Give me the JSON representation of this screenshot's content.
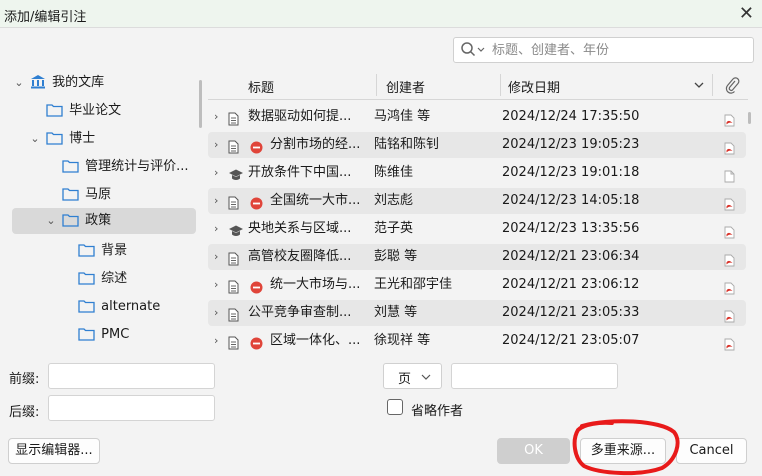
{
  "window": {
    "title": "添加/编辑引注",
    "close_glyph": "✕"
  },
  "search": {
    "placeholder": "标题、创建者、年份",
    "value": ""
  },
  "tree": {
    "items": [
      {
        "label": "我的文库",
        "icon": "library-icon",
        "twisty": "⌄"
      },
      {
        "label": "毕业论文",
        "icon": "folder-icon",
        "twisty": ""
      },
      {
        "label": "博士",
        "icon": "folder-icon",
        "twisty": "⌄"
      },
      {
        "label": "管理统计与评价...",
        "icon": "folder-icon",
        "twisty": ""
      },
      {
        "label": "马原",
        "icon": "folder-icon",
        "twisty": ""
      },
      {
        "label": "政策",
        "icon": "folder-icon",
        "twisty": "⌄"
      },
      {
        "label": "背景",
        "icon": "folder-icon",
        "twisty": ""
      },
      {
        "label": "综述",
        "icon": "folder-icon",
        "twisty": ""
      },
      {
        "label": "alternate",
        "icon": "folder-icon",
        "twisty": ""
      },
      {
        "label": "PMC",
        "icon": "folder-icon",
        "twisty": ""
      }
    ]
  },
  "table": {
    "headers": {
      "title": "标题",
      "creator": "创建者",
      "date": "修改日期",
      "attachment_icon": "paperclip-icon"
    },
    "rows": [
      {
        "type": "document",
        "retracted": false,
        "title": "数据驱动如何提...",
        "creator": "马鸿佳 等",
        "date": "2024/12/24 17:35:50",
        "attachment": "pdf"
      },
      {
        "type": "document",
        "retracted": true,
        "title": "分割市场的经...",
        "creator": "陆铭和陈钊",
        "date": "2024/12/23 19:05:23",
        "attachment": "pdf"
      },
      {
        "type": "thesis",
        "retracted": false,
        "title": "开放条件下中国...",
        "creator": "陈维佳",
        "date": "2024/12/23 19:01:18",
        "attachment": "file"
      },
      {
        "type": "document",
        "retracted": true,
        "title": "全国统一大市...",
        "creator": "刘志彪",
        "date": "2024/12/23 14:05:18",
        "attachment": "pdf"
      },
      {
        "type": "thesis",
        "retracted": false,
        "title": "央地关系与区域...",
        "creator": "范子英",
        "date": "2024/12/23 13:35:56",
        "attachment": "pdf"
      },
      {
        "type": "document",
        "retracted": false,
        "title": "高管校友圈降低...",
        "creator": "彭聪 等",
        "date": "2024/12/21 23:06:34",
        "attachment": "pdf"
      },
      {
        "type": "document",
        "retracted": true,
        "title": "统一大市场与...",
        "creator": "王光和邵宇佳",
        "date": "2024/12/21 23:06:12",
        "attachment": "pdf"
      },
      {
        "type": "document",
        "retracted": false,
        "title": "公平竞争审查制...",
        "creator": "刘慧 等",
        "date": "2024/12/21 23:05:33",
        "attachment": "pdf"
      },
      {
        "type": "document",
        "retracted": true,
        "title": "区域一体化、...",
        "creator": "徐现祥 等",
        "date": "2024/12/21 23:05:07",
        "attachment": "pdf"
      }
    ]
  },
  "form": {
    "prefix_label": "前缀:",
    "suffix_label": "后缀:",
    "prefix_value": "",
    "suffix_value": "",
    "locator_type": "页",
    "locator_value": "",
    "omit_author_label": "省略作者",
    "omit_author_checked": false
  },
  "buttons": {
    "show_editor": "显示编辑器...",
    "ok": "OK",
    "multiple_sources": "多重来源...",
    "cancel": "Cancel"
  },
  "colors": {
    "retracted": "#e0453a",
    "pdf": "#d9342b",
    "annotation_circle": "#e81a1a",
    "selected_bg": "#d9d9d9"
  }
}
